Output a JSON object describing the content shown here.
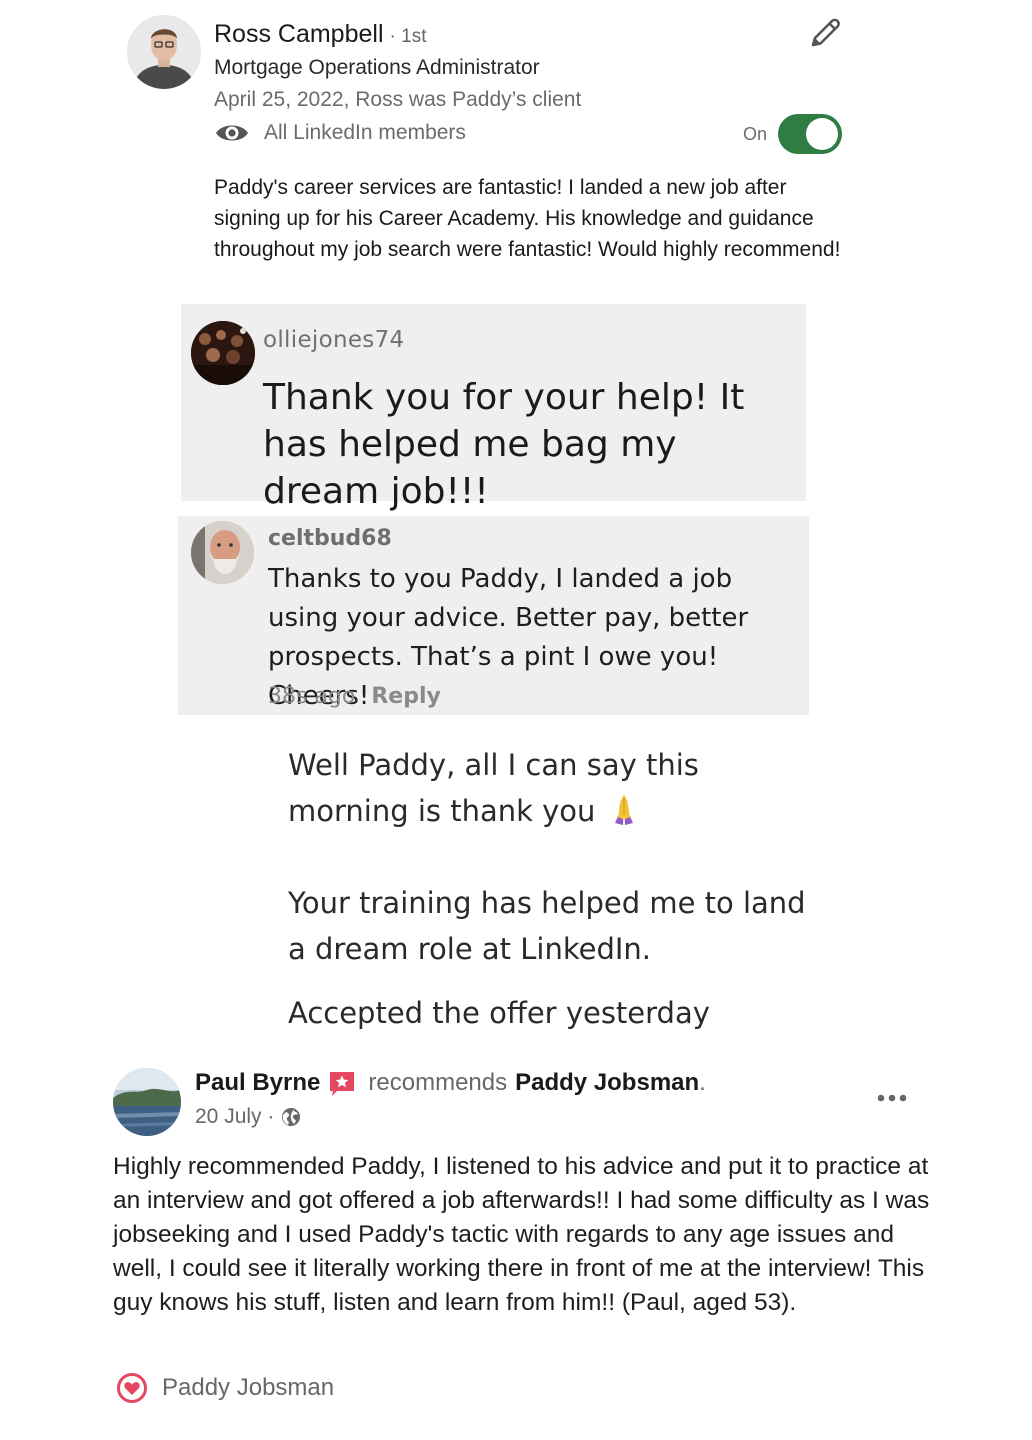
{
  "linkedin": {
    "name": "Ross Campbell",
    "degree": "· 1st",
    "title": "Mortgage Operations Administrator",
    "date_relation": "April 25, 2022, Ross was Paddy’s client",
    "visibility": "All LinkedIn members",
    "toggle_label": "On",
    "toggle_state": true,
    "body": "Paddy's career services are fantastic! I landed a new job after signing up for his Career Academy. His knowledge and guidance throughout my job search were fantastic! Would highly recommend!",
    "icons": {
      "edit": "pencil-icon",
      "visibility": "eye-icon"
    },
    "toggle_color": "#2f7d43"
  },
  "comment1": {
    "user": "olliejones74",
    "text": "Thank you for your help! It has helped me bag my dream job!!!"
  },
  "comment2": {
    "user": "celtbud68",
    "text": "Thanks to you Paddy, I landed a job using your advice. Better pay, better prospects. That’s a pint I owe you! Cheers!",
    "time": "38s ago",
    "reply": "Reply"
  },
  "message": {
    "line1": "Well Paddy, all I can say this morning is thank you",
    "emoji": "pray-icon",
    "line2": "Your training has helped me to land a dream role at LinkedIn.",
    "line3": "Accepted the offer yesterday"
  },
  "facebook": {
    "name": "Paul Byrne",
    "verb": "recommends",
    "page": "Paddy Jobsman",
    "period": ".",
    "date": "20 July ·",
    "body": "Highly recommended Paddy, I listened to his advice and put it to practice at an interview and got offered a job afterwards!! I had some difficulty as I was jobseeking and I used Paddy's tactic with regards to any age issues and well, I could see it literally working there in front of me at the interview! This guy knows his stuff, listen and learn from him!! (Paul, aged 53).",
    "reaction_name": "Paddy Jobsman",
    "icons": {
      "recommend": "recommend-icon",
      "audience": "globe-icon",
      "more": "more-icon",
      "reaction": "heart-icon"
    },
    "accent": "#e4475f"
  }
}
